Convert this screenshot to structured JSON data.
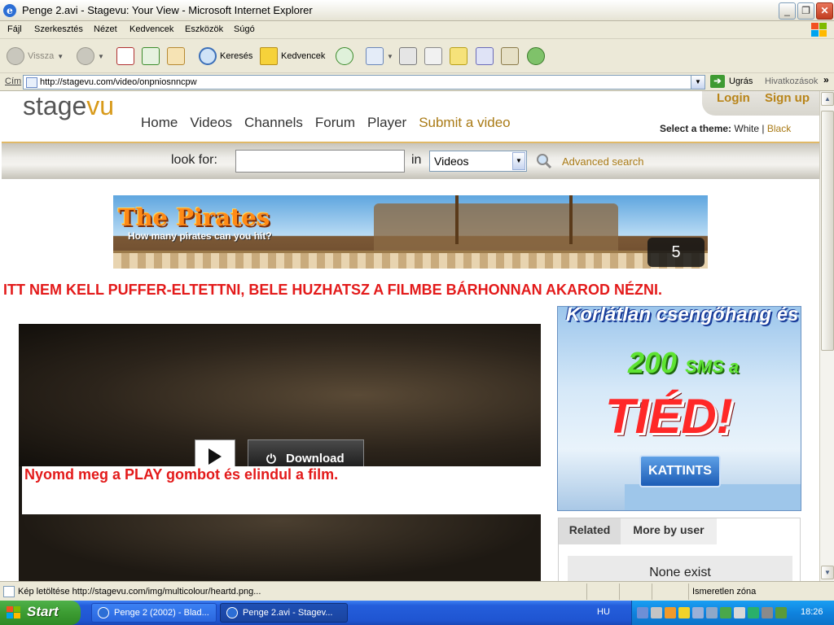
{
  "window": {
    "title": "Penge 2.avi - Stagevu: Your View - Microsoft Internet Explorer",
    "controls": {
      "minimize": "_",
      "maximize": "❐",
      "close": "✕"
    }
  },
  "menu": [
    "Fájl",
    "Szerkesztés",
    "Nézet",
    "Kedvencek",
    "Eszközök",
    "Súgó"
  ],
  "toolbar": {
    "back": "Vissza",
    "search": "Keresés",
    "favorites": "Kedvencek"
  },
  "address": {
    "label": "Cím",
    "url": "http://stagevu.com/video/onpniosnncpw",
    "go": "Ugrás",
    "links": "Hivatkozások",
    "more": "»"
  },
  "site": {
    "logo_a": "stage",
    "logo_b": "vu",
    "nav": [
      "Home",
      "Videos",
      "Channels",
      "Forum",
      "Player",
      "Submit a video"
    ],
    "login": "Login",
    "signup": "Sign up",
    "theme_label": "Select a theme:",
    "theme_white": "White",
    "theme_sep": "|",
    "theme_black": "Black"
  },
  "search": {
    "look_for": "look for:",
    "query": "",
    "in": "in",
    "scope": "Videos",
    "advanced": "Advanced search"
  },
  "banner": {
    "title": "The Pirates",
    "subtitle": "How many pirates can you hit?",
    "counter": "5"
  },
  "notice": "ITT NEM KELL PUFFER-ELTETTNI, BELE HUZHATSZ A FILMBE BÁRHONNAN AKAROD NÉZNI.",
  "player": {
    "download": "Download",
    "overlay_text": "Nyomd meg a PLAY gombot és elindul a film."
  },
  "side_ad": {
    "line1": "Korlátlan csengőhang és",
    "line2_num": "200",
    "line2_sms": "SMS a",
    "line3": "TIÉD!",
    "button": "KATTINTS"
  },
  "related": {
    "tab_related": "Related",
    "tab_more": "More by user",
    "empty": "None exist"
  },
  "status": {
    "text": "Kép letöltése http://stagevu.com/img/multicolour/heartd.png...",
    "zone": "Ismeretlen zóna"
  },
  "taskbar": {
    "start": "Start",
    "tasks": [
      "Penge 2 (2002) - Blad...",
      "Penge 2.avi - Stagev..."
    ],
    "language": "HU",
    "clock": "18:26"
  },
  "colors": {
    "accent_gold": "#a97a15",
    "notice_red": "#e31a1a",
    "xp_blue": "#245edb"
  }
}
